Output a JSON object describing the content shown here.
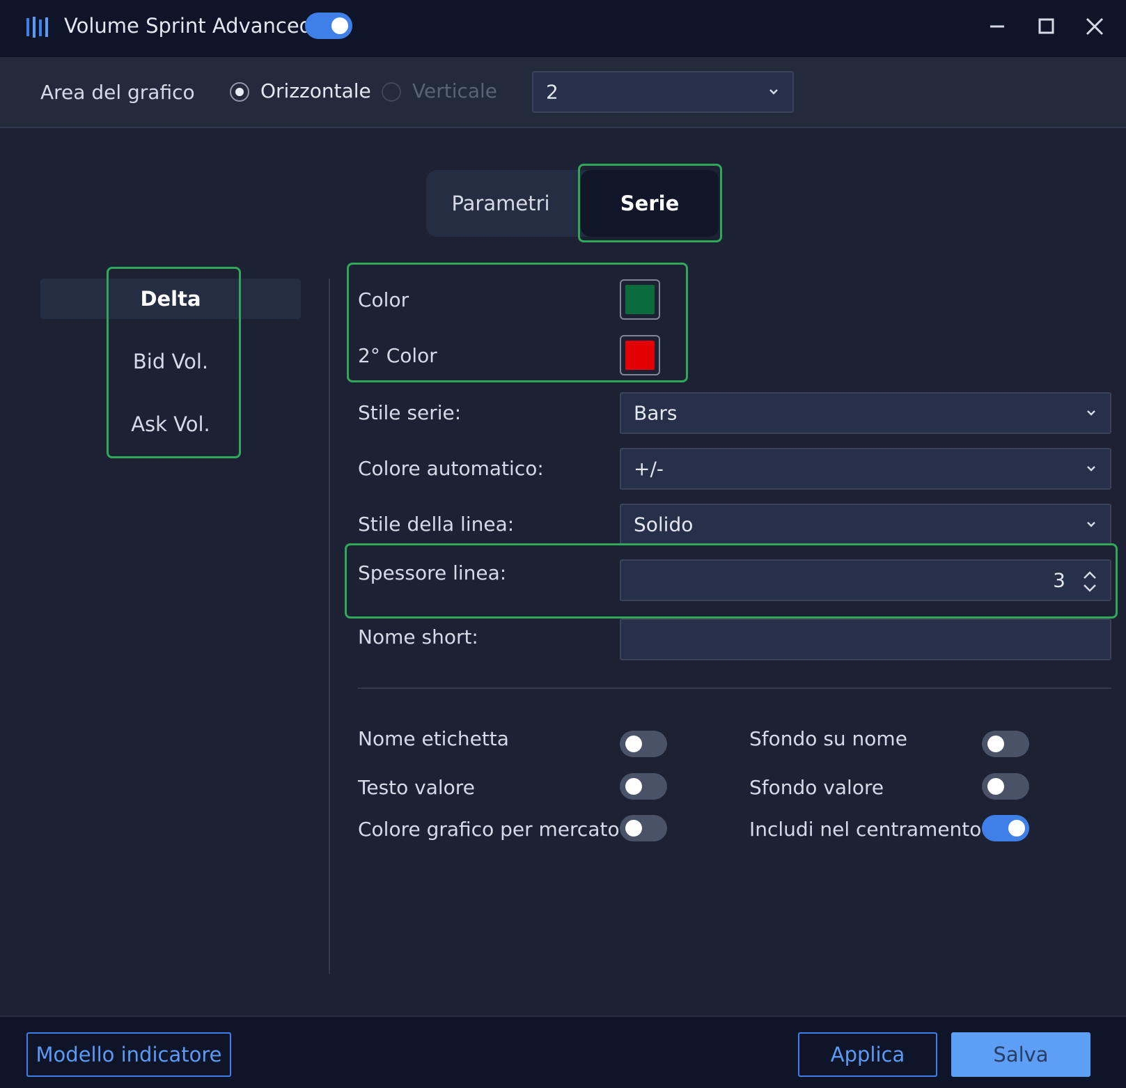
{
  "window": {
    "title": "Volume Sprint Advanced",
    "enabled": true
  },
  "chart_area": {
    "label": "Area del grafico",
    "options": [
      {
        "label": "Orizzontale",
        "checked": true
      },
      {
        "label": "Verticale",
        "checked": false,
        "disabled": true
      }
    ],
    "panel_select": "2"
  },
  "tabs": [
    {
      "label": "Parametri",
      "active": false
    },
    {
      "label": "Serie",
      "active": true
    }
  ],
  "series": [
    {
      "label": "Delta",
      "selected": true
    },
    {
      "label": "Bid Vol.",
      "selected": false
    },
    {
      "label": "Ask Vol.",
      "selected": false
    }
  ],
  "settings": {
    "color": {
      "label": "Color",
      "value": "#0a6b3c"
    },
    "color2": {
      "label": "2° Color",
      "value": "#e30000"
    },
    "series_style": {
      "label": "Stile serie:",
      "value": "Bars"
    },
    "auto_color": {
      "label": "Colore automatico:",
      "value": "+/-"
    },
    "line_style": {
      "label": "Stile della linea:",
      "value": "Solido"
    },
    "line_width": {
      "label": "Spessore linea:",
      "value": "3"
    },
    "short_name": {
      "label": "Nome short:",
      "value": ""
    }
  },
  "toggles": [
    {
      "label": "Nome etichetta",
      "on": false
    },
    {
      "label": "Sfondo su nome",
      "on": false
    },
    {
      "label": "Testo valore",
      "on": false
    },
    {
      "label": "Sfondo valore",
      "on": false
    },
    {
      "label": "Colore grafico per mercato",
      "on": false
    },
    {
      "label": "Includi nel centramento",
      "on": true
    }
  ],
  "footer": {
    "template_button": "Modello indicatore",
    "apply_button": "Applica",
    "save_button": "Salva"
  },
  "colors": {
    "accent": "#3f7fe8",
    "highlight": "#2fa85a"
  }
}
